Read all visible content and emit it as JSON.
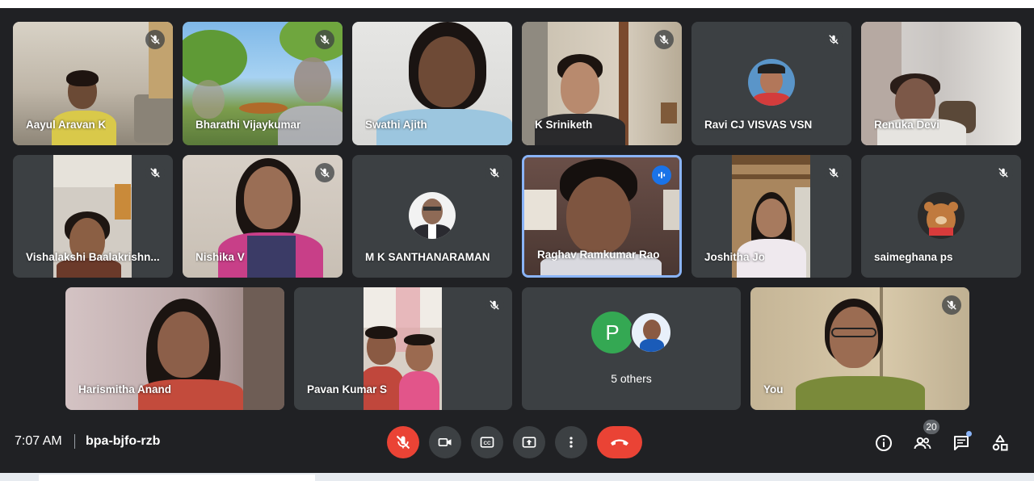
{
  "participants": [
    {
      "name": "Aayul Aravan K",
      "muted": true
    },
    {
      "name": "Bharathi Vijaykumar",
      "muted": true
    },
    {
      "name": "Swathi Ajith",
      "muted": false
    },
    {
      "name": "K Sriniketh",
      "muted": true
    },
    {
      "name": "Ravi CJ VISVAS VSN",
      "muted": true
    },
    {
      "name": "Renuka Devi",
      "muted": false
    },
    {
      "name": "Vishalakshi Baalakrishn...",
      "muted": true
    },
    {
      "name": "Nishika V",
      "muted": true
    },
    {
      "name": "M K SANTHANARAMAN",
      "muted": true
    },
    {
      "name": "Raghav Ramkumar Rao",
      "muted": false,
      "speaking": true
    },
    {
      "name": "Joshitha Jo",
      "muted": true
    },
    {
      "name": "saimeghana ps",
      "muted": true
    },
    {
      "name": "Harismitha Anand",
      "muted": false
    },
    {
      "name": "Pavan Kumar S",
      "muted": true
    },
    {
      "name": "You",
      "muted": true
    }
  ],
  "others": {
    "label": "5 others",
    "avatar_letter": "P"
  },
  "bottombar": {
    "time": "7:07 AM",
    "meeting_code": "bpa-bjfo-rzb",
    "participant_count": "20"
  },
  "colors": {
    "background": "#202124",
    "tile": "#3c4043",
    "accent_red": "#ea4335",
    "speaking_blue": "#8ab4f8",
    "avatar_green": "#34a853"
  },
  "icons": [
    "mic-off-icon",
    "camera-icon",
    "captions-icon",
    "present-icon",
    "more-vert-icon",
    "end-call-icon",
    "info-icon",
    "people-icon",
    "chat-icon",
    "activities-icon"
  ]
}
